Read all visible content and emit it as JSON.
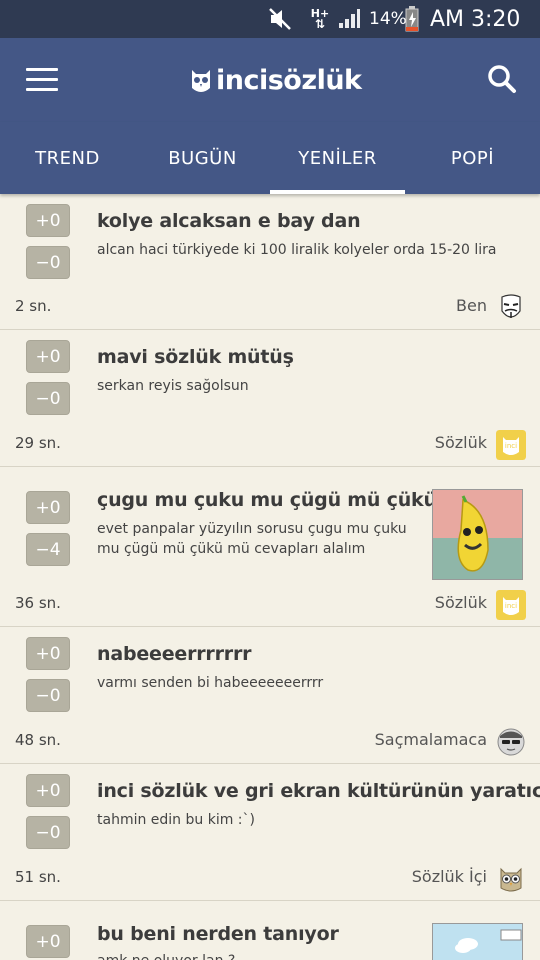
{
  "status_bar": {
    "network": "H+",
    "battery_pct": "14%",
    "time": "AM 3:20",
    "icons": [
      "mute-icon",
      "network-arrows-icon",
      "signal-icon",
      "battery-charging-icon"
    ]
  },
  "app_bar": {
    "logo_text": "incisözlük",
    "logo_icon": "owl-icon",
    "menu_icon": "hamburger-menu-icon",
    "search_icon": "search-icon",
    "color": "#445786"
  },
  "tabs": [
    {
      "label": "TREND",
      "active": false
    },
    {
      "label": "BUGÜN",
      "active": false
    },
    {
      "label": "YENİLER",
      "active": true
    },
    {
      "label": "POPİ",
      "active": false
    }
  ],
  "posts": [
    {
      "up": "+0",
      "down": "−0",
      "title": "kolye alcaksan e bay dan",
      "body": "alcan haci türkiyede ki 100 liralik kolyeler orda 15-20 lira",
      "time": "2 sn.",
      "author": "Ben",
      "avatar": "mask-avatar-icon"
    },
    {
      "up": "+0",
      "down": "−0",
      "title": "mavi sözlük mütüş",
      "body": "serkan reyis sağolsun",
      "time": "29 sn.",
      "author": "Sözlük",
      "avatar": "inci-logo-avatar-icon"
    },
    {
      "up": "+0",
      "down": "−4",
      "title": "çugu mu çuku mu çügü mü çükü mü",
      "body": "evet panpalar yüzyılın sorusu çugu mu çuku mu çügü mü çükü mü cevapları alalım",
      "time": "36 sn.",
      "author": "Sözlük",
      "avatar": "inci-logo-avatar-icon",
      "thumbnail": "banana-image"
    },
    {
      "up": "+0",
      "down": "−0",
      "title": "nabeeeerrrrrrr",
      "body": "varmı senden bi habeeeeeeerrrr",
      "time": "48 sn.",
      "author": "Saçmalamaca",
      "avatar": "sunglasses-avatar-icon"
    },
    {
      "up": "+0",
      "down": "−0",
      "title": "inci sözlük ve gri ekran kültürünün yaratıcısı",
      "body": "tahmin edin bu kim :`)",
      "time": "51 sn.",
      "author": "Sözlük İçi",
      "avatar": "owl-avatar-icon"
    },
    {
      "up": "+0",
      "down": "",
      "title": "bu beni nerden tanıyor",
      "body": "amk ne oluyor lan ?",
      "time": "",
      "author": "",
      "avatar": "",
      "thumbnail": "screenshot-image"
    }
  ]
}
